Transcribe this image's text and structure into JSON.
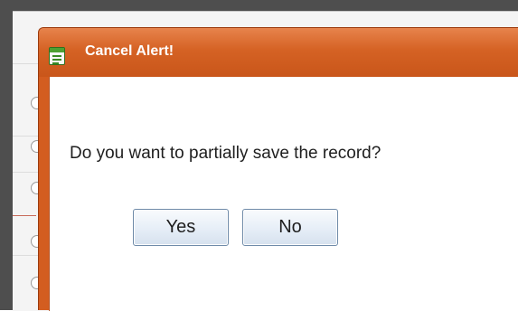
{
  "dialog": {
    "title": "Cancel Alert!",
    "message": "Do you want to partially save the record?",
    "buttons": {
      "yes_label": "Yes",
      "no_label": "No"
    },
    "icon": "notepad-icon",
    "colors": {
      "titlebar": "#d56224",
      "title_text": "#ffffff",
      "body": "#ffffff"
    }
  }
}
